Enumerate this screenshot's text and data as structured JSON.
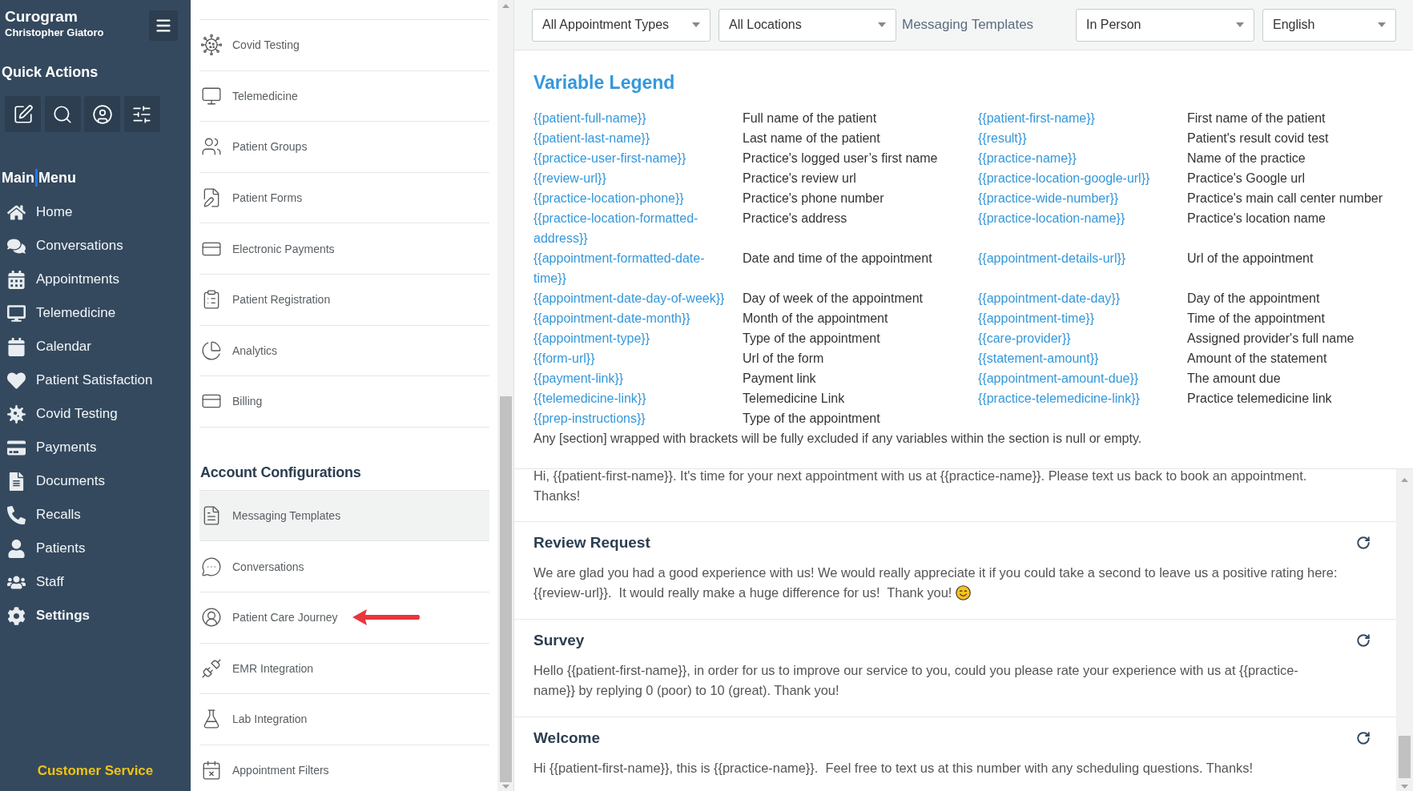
{
  "sidebar": {
    "brand": "Curogram",
    "user_name": "Christopher Giatoro",
    "quick_actions_title": "Quick Actions",
    "main_menu_title_parts": [
      "Main",
      "Menu"
    ],
    "menu": [
      {
        "label": "Home",
        "selected": false
      },
      {
        "label": "Conversations",
        "selected": false
      },
      {
        "label": "Appointments",
        "selected": false
      },
      {
        "label": "Telemedicine",
        "selected": false
      },
      {
        "label": "Calendar",
        "selected": false
      },
      {
        "label": "Patient Satisfaction",
        "selected": false
      },
      {
        "label": "Covid Testing",
        "selected": false
      },
      {
        "label": "Payments",
        "selected": false
      },
      {
        "label": "Documents",
        "selected": false
      },
      {
        "label": "Recalls",
        "selected": false
      },
      {
        "label": "Patients",
        "selected": false
      },
      {
        "label": "Staff",
        "selected": false
      },
      {
        "label": "Settings",
        "selected": true
      }
    ],
    "footer_link": "Customer Service"
  },
  "settings_menu": {
    "items": [
      {
        "label": "Covid Testing",
        "selected": false
      },
      {
        "label": "Telemedicine",
        "selected": false
      },
      {
        "label": "Patient Groups",
        "selected": false
      },
      {
        "label": "Patient Forms",
        "selected": false
      },
      {
        "label": "Electronic Payments",
        "selected": false
      },
      {
        "label": "Patient Registration",
        "selected": false
      },
      {
        "label": "Analytics",
        "selected": false
      },
      {
        "label": "Billing",
        "selected": false
      }
    ],
    "account_section": {
      "title": "Account Configurations",
      "items": [
        {
          "label": "Messaging Templates",
          "selected": true,
          "arrow_annotation": false
        },
        {
          "label": "Conversations",
          "selected": false,
          "arrow_annotation": false
        },
        {
          "label": "Patient Care Journey",
          "selected": false,
          "arrow_annotation": true
        },
        {
          "label": "EMR Integration",
          "selected": false,
          "arrow_annotation": false
        },
        {
          "label": "Lab Integration",
          "selected": false,
          "arrow_annotation": false
        },
        {
          "label": "Appointment Filters",
          "selected": false,
          "arrow_annotation": false
        }
      ]
    }
  },
  "toolbar": {
    "filters_left": [
      {
        "value": "All Appointment Types"
      },
      {
        "value": "All Locations"
      }
    ],
    "title": "Messaging Templates",
    "filters_right": [
      {
        "value": "In Person"
      },
      {
        "value": "English"
      }
    ]
  },
  "variable_legend": {
    "title": "Variable Legend",
    "rows": [
      {
        "pairs": [
          {
            "variable": "{{patient-full-name}}",
            "description": "Full name of the patient"
          },
          {
            "variable": "{{patient-first-name}}",
            "description": "First name of the patient"
          }
        ]
      },
      {
        "pairs": [
          {
            "variable": "{{patient-last-name}}",
            "description": "Last name of the patient"
          },
          {
            "variable": "{{result}}",
            "description": "Patient's result covid test"
          }
        ]
      },
      {
        "pairs": [
          {
            "variable": "{{practice-user-first-name}}",
            "description": "Practice's logged user’s first name"
          },
          {
            "variable": "{{practice-name}}",
            "description": "Name of the practice"
          }
        ]
      },
      {
        "pairs": [
          {
            "variable": "{{review-url}}",
            "description": "Practice's review url"
          },
          {
            "variable": "{{practice-location-google-url}}",
            "description": "Practice's Google url"
          }
        ]
      },
      {
        "pairs": [
          {
            "variable": "{{practice-location-phone}}",
            "description": "Practice's phone number"
          },
          {
            "variable": "{{practice-wide-number}}",
            "description": "Practice's main call center number"
          }
        ]
      },
      {
        "pairs": [
          {
            "variable": "{{practice-location-formatted-address}}",
            "description": "Practice's address"
          },
          {
            "variable": "{{practice-location-name}}",
            "description": "Practice's location name"
          }
        ]
      },
      {
        "pairs": [
          {
            "variable": "{{appointment-formatted-date-time}}",
            "description": "Date and time of the appointment"
          },
          {
            "variable": "{{appointment-details-url}}",
            "description": "Url of the appointment"
          }
        ]
      },
      {
        "pairs": [
          {
            "variable": "{{appointment-date-day-of-week}}",
            "description": "Day of week of the appointment"
          },
          {
            "variable": "{{appointment-date-day}}",
            "description": "Day of the appointment"
          }
        ]
      },
      {
        "pairs": [
          {
            "variable": "{{appointment-date-month}}",
            "description": "Month of the appointment"
          },
          {
            "variable": "{{appointment-time}}",
            "description": "Time of the appointment"
          }
        ]
      },
      {
        "pairs": [
          {
            "variable": "{{appointment-type}}",
            "description": "Type of the appointment"
          },
          {
            "variable": "{{care-provider}}",
            "description": "Assigned provider's full name"
          }
        ]
      },
      {
        "pairs": [
          {
            "variable": "{{form-url}}",
            "description": "Url of the form"
          },
          {
            "variable": "{{statement-amount}}",
            "description": "Amount of the statement"
          }
        ]
      },
      {
        "pairs": [
          {
            "variable": "{{payment-link}}",
            "description": "Payment link"
          },
          {
            "variable": "{{appointment-amount-due}}",
            "description": "The amount due"
          }
        ]
      },
      {
        "pairs": [
          {
            "variable": "{{telemedicine-link}}",
            "description": "Telemedicine Link"
          },
          {
            "variable": "{{practice-telemedicine-link}}",
            "description": "Practice telemedicine link"
          }
        ]
      },
      {
        "pairs": [
          {
            "variable": "{{prep-instructions}}",
            "description": "Type of the appointment"
          }
        ]
      }
    ],
    "note": "Any [section] wrapped with brackets will be fully excluded if any variables within the section is null or empty."
  },
  "templates": [
    {
      "body": "Hi, {{patient-first-name}}. It's time for your next appointment with us at {{practice-name}}. Please text us back to book an appointment. Thanks!",
      "smiley": false
    },
    {
      "title": "Review Request",
      "body": "We are glad you had a good experience with us! We would really appreciate it if you could take a second to leave us a positive rating here: {{review-url}}.  It would really make a huge difference for us!  Thank you!",
      "smiley": true
    },
    {
      "title": "Survey",
      "body": "Hello {{patient-first-name}}, in order for us to improve our service to you, could you please rate your experience with us at {{practice-name}} by replying 0 (poor) to 10 (great). Thank you!",
      "smiley": false
    },
    {
      "title": "Welcome",
      "body": "Hi {{patient-first-name}}, this is {{practice-name}}.  Feel free to text us at this number with any scheduling questions. Thanks!",
      "smiley": false
    }
  ]
}
